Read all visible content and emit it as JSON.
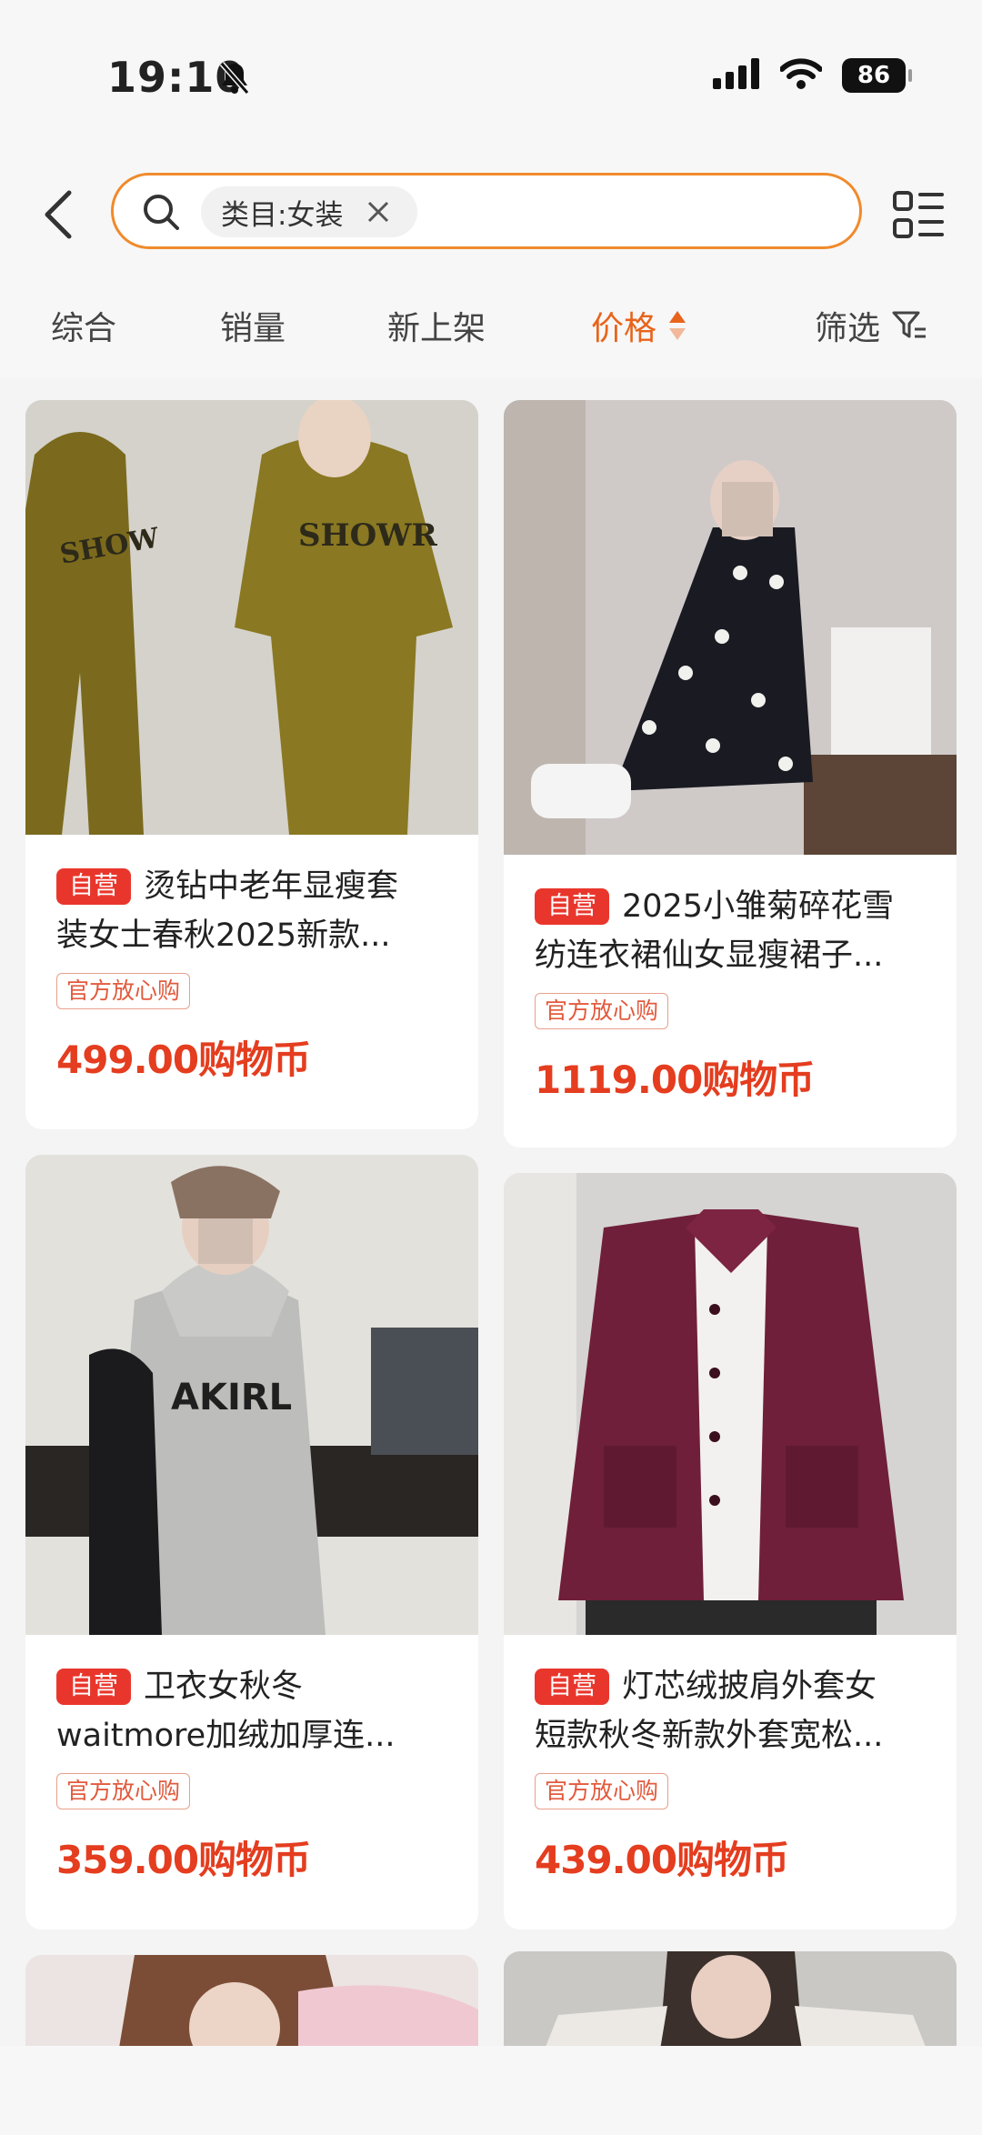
{
  "status": {
    "time": "19:10",
    "battery": "86"
  },
  "search": {
    "tag": "类目:女装"
  },
  "sort": {
    "items": [
      "综合",
      "销量",
      "新上架",
      "价格",
      "筛选"
    ],
    "active": "价格"
  },
  "products": [
    {
      "badge": "自营",
      "title_line1": "烫钻中老年显瘦套",
      "title_line2": "装女士春秋2025新款...",
      "tag": "官方放心购",
      "price": "499.00购物币"
    },
    {
      "badge": "自营",
      "title_line1": "2025小雏菊碎花雪",
      "title_line2": "纺连衣裙仙女显瘦裙子...",
      "tag": "官方放心购",
      "price": "1119.00购物币"
    },
    {
      "badge": "自营",
      "title_line1": "卫衣女秋冬",
      "title_line2": "waitmore加绒加厚连...",
      "tag": "官方放心购",
      "price": "359.00购物币"
    },
    {
      "badge": "自营",
      "title_line1": "灯芯绒披肩外套女",
      "title_line2": "短款秋冬新款外套宽松...",
      "tag": "官方放心购",
      "price": "439.00购物币"
    }
  ],
  "image_text": {
    "hoodie_print": "AKIRL"
  },
  "colors": {
    "accent": "#e8641b",
    "price": "#e43d1f",
    "badge": "#e9362c",
    "search_border": "#f08a2c"
  },
  "icons": [
    "bell-off-icon",
    "signal-icon",
    "wifi-icon",
    "back-arrow-icon",
    "search-icon",
    "close-icon",
    "layout-toggle-icon",
    "sort-arrow-icon",
    "filter-icon"
  ]
}
